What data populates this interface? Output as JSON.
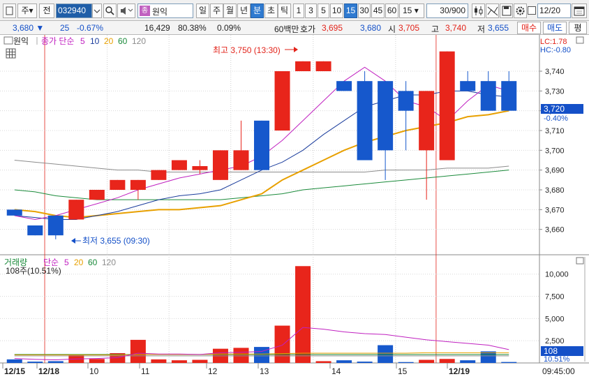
{
  "toolbar": {
    "market_type": "주",
    "prev_label": "전",
    "stock_code": "032940",
    "stock_name": "원익",
    "stock_tag": "종",
    "periods": [
      "일",
      "주",
      "월",
      "년",
      "분",
      "초",
      "틱"
    ],
    "selected_period": "분",
    "intervals": [
      "1",
      "3",
      "5",
      "10",
      "15",
      "30",
      "45",
      "60"
    ],
    "selected_interval": "15",
    "interval_select": "15",
    "count_value": "30/900",
    "date_value": "12/20"
  },
  "quote": {
    "price": "3,680",
    "change": "25",
    "change_pct": "-0.67%",
    "volume": "16,429",
    "vol_ratio": "80.38%",
    "turnover": "0.09%",
    "amount_label": "60백만",
    "ask_label": "호가",
    "ask": "3,695",
    "bid": "3,680",
    "open_label": "시",
    "open": "3,705",
    "high_label": "고",
    "high": "3,740",
    "low_label": "저",
    "low": "3,655",
    "buy_button": "매수",
    "sell_button": "매도",
    "eval_button": "평"
  },
  "price_panel": {
    "name": "원익",
    "ma_title": "종가 단순",
    "ma_periods": [
      "5",
      "10",
      "20",
      "60",
      "120"
    ],
    "ma_colors": [
      "#c020c0",
      "#1a3c9c",
      "#e8a000",
      "#1a8a3a",
      "#8c8c8c"
    ],
    "lc": "LC:1.78",
    "hc": "HC:-0.80",
    "high_annot": "최고 3,750 (13:30)",
    "low_annot": "최저 3,655 (09:30)",
    "current_price": "3,720",
    "current_pct": "-0.40%",
    "y_ticks": [
      "3,740",
      "3,730",
      "3,720",
      "3,710",
      "3,700",
      "3,690",
      "3,680",
      "3,670",
      "3,660"
    ]
  },
  "volume_panel": {
    "title": "거래량",
    "ma_label": "단순",
    "ma_periods": [
      "5",
      "20",
      "60",
      "120"
    ],
    "sub": "108주(10.51%)",
    "y_ticks": [
      "10,000",
      "7,500",
      "5,000",
      "2,500"
    ],
    "current_vol": "108",
    "current_pct": "10.51%"
  },
  "x_axis": {
    "labels": [
      "12/15",
      "12/18",
      "10",
      "11",
      "12",
      "13",
      "14",
      "15",
      "12/19"
    ],
    "time": "09:45:00"
  },
  "chart_data": {
    "type": "candlestick",
    "price_range": [
      3650,
      3752
    ],
    "volume_range": [
      0,
      11000
    ],
    "candles": [
      {
        "o": 3670,
        "h": 3670,
        "l": 3667,
        "c": 3667,
        "v": 400
      },
      {
        "o": 3662,
        "h": 3662,
        "l": 3657,
        "c": 3657,
        "v": 150
      },
      {
        "o": 3667,
        "h": 3667,
        "l": 3655,
        "c": 3657,
        "v": 200
      },
      {
        "o": 3665,
        "h": 3675,
        "l": 3665,
        "c": 3675,
        "v": 900
      },
      {
        "o": 3675,
        "h": 3680,
        "l": 3675,
        "c": 3680,
        "v": 450
      },
      {
        "o": 3680,
        "h": 3685,
        "l": 3680,
        "c": 3685,
        "v": 1100
      },
      {
        "o": 3680,
        "h": 3685,
        "l": 3675,
        "c": 3685,
        "v": 2600
      },
      {
        "o": 3685,
        "h": 3690,
        "l": 3685,
        "c": 3690,
        "v": 400
      },
      {
        "o": 3690,
        "h": 3695,
        "l": 3690,
        "c": 3695,
        "v": 300
      },
      {
        "o": 3690,
        "h": 3695,
        "l": 3688,
        "c": 3692,
        "v": 350
      },
      {
        "o": 3685,
        "h": 3700,
        "l": 3685,
        "c": 3700,
        "v": 1600
      },
      {
        "o": 3690,
        "h": 3715,
        "l": 3690,
        "c": 3700,
        "v": 1700
      },
      {
        "o": 3715,
        "h": 3715,
        "l": 3690,
        "c": 3690,
        "v": 1800
      },
      {
        "o": 3710,
        "h": 3740,
        "l": 3710,
        "c": 3740,
        "v": 4200
      },
      {
        "o": 3740,
        "h": 3745,
        "l": 3740,
        "c": 3745,
        "v": 10900
      },
      {
        "o": 3740,
        "h": 3745,
        "l": 3740,
        "c": 3745,
        "v": 200
      },
      {
        "o": 3735,
        "h": 3735,
        "l": 3730,
        "c": 3730,
        "v": 300
      },
      {
        "o": 3735,
        "h": 3740,
        "l": 3695,
        "c": 3695,
        "v": 150
      },
      {
        "o": 3735,
        "h": 3735,
        "l": 3685,
        "c": 3700,
        "v": 2000
      },
      {
        "o": 3730,
        "h": 3735,
        "l": 3700,
        "c": 3720,
        "v": 100
      },
      {
        "o": 3700,
        "h": 3730,
        "l": 3675,
        "c": 3730,
        "v": 350
      },
      {
        "o": 3695,
        "h": 3750,
        "l": 3695,
        "c": 3750,
        "v": 450
      },
      {
        "o": 3735,
        "h": 3740,
        "l": 3730,
        "c": 3730,
        "v": 300
      },
      {
        "o": 3735,
        "h": 3740,
        "l": 3720,
        "c": 3720,
        "v": 1300
      },
      {
        "o": 3735,
        "h": 3740,
        "l": 3720,
        "c": 3720,
        "v": 108
      }
    ],
    "ma5": [
      3667,
      3665,
      3667,
      3670,
      3673,
      3676,
      3680,
      3683,
      3686,
      3688,
      3690,
      3692,
      3697,
      3705,
      3715,
      3725,
      3735,
      3742,
      3735,
      3725,
      3722,
      3715,
      3725,
      3733,
      3730
    ],
    "ma10": [
      3667,
      3666,
      3665,
      3665,
      3667,
      3669,
      3672,
      3675,
      3677,
      3678,
      3680,
      3685,
      3690,
      3694,
      3700,
      3708,
      3715,
      3722,
      3725,
      3728,
      3728,
      3730,
      3730,
      3728,
      3727
    ],
    "ma20": [
      3670,
      3669,
      3667,
      3666,
      3667,
      3668,
      3669,
      3670,
      3670,
      3671,
      3672,
      3675,
      3678,
      3685,
      3690,
      3695,
      3700,
      3704,
      3707,
      3710,
      3712,
      3714,
      3717,
      3718,
      3720
    ],
    "ma60": [
      3680,
      3679,
      3677,
      3676,
      3675,
      3675,
      3675,
      3675,
      3675,
      3675,
      3675,
      3676,
      3677,
      3678,
      3680,
      3681,
      3682,
      3683,
      3684,
      3685,
      3686,
      3687,
      3688,
      3689,
      3690
    ],
    "ma120": [
      3695,
      3694,
      3693,
      3692,
      3691,
      3690,
      3690,
      3689,
      3689,
      3689,
      3689,
      3689,
      3689,
      3689,
      3689,
      3689,
      3689,
      3689,
      3690,
      3690,
      3690,
      3691,
      3691,
      3691,
      3692
    ],
    "vma5": [
      500,
      400,
      350,
      450,
      500,
      600,
      1100,
      1000,
      1000,
      950,
      1150,
      1200,
      1300,
      2000,
      4000,
      3800,
      3500,
      3300,
      3200,
      2900,
      2600,
      2400,
      2200,
      2000,
      1500
    ],
    "vma20": [
      900,
      900,
      900,
      900,
      900,
      900,
      950,
      950,
      950,
      950,
      1000,
      1000,
      1000,
      1050,
      1100,
      1100,
      1100,
      1100,
      1100,
      1100,
      1150,
      1150,
      1150,
      1150,
      1150
    ],
    "vma60": [
      950,
      950,
      950,
      950,
      950,
      950,
      950,
      950,
      950,
      950,
      950,
      950,
      950,
      950,
      950,
      950,
      950,
      950,
      950,
      950,
      950,
      950,
      950,
      950,
      950
    ],
    "vma120": [
      800,
      800,
      800,
      800,
      800,
      800,
      800,
      800,
      800,
      800,
      800,
      800,
      800,
      800,
      800,
      800,
      800,
      800,
      800,
      800,
      800,
      800,
      800,
      800,
      800
    ]
  }
}
